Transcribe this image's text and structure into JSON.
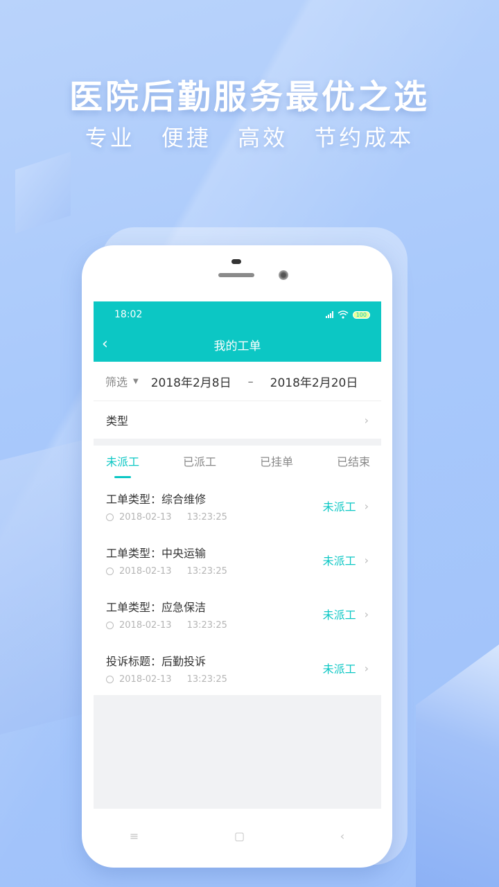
{
  "promo": {
    "headline": "医院后勤服务最优之选",
    "tags": [
      "专业",
      "便捷",
      "高效",
      "节约成本"
    ]
  },
  "status": {
    "time": "18:02",
    "battery": "100"
  },
  "appbar": {
    "title": "我的工单"
  },
  "filter": {
    "label": "筛选",
    "start_date": "2018年2月8日",
    "separator": "–",
    "end_date": "2018年2月20日"
  },
  "type_row": {
    "label": "类型"
  },
  "tabs": [
    "未派工",
    "已派工",
    "已挂单",
    "已结束"
  ],
  "orders": [
    {
      "title": "工单类型：综合维修",
      "date": "2018-02-13",
      "time": "13:23:25",
      "status": "未派工"
    },
    {
      "title": "工单类型：中央运输",
      "date": "2018-02-13",
      "time": "13:23:25",
      "status": "未派工"
    },
    {
      "title": "工单类型：应急保洁",
      "date": "2018-02-13",
      "time": "13:23:25",
      "status": "未派工"
    },
    {
      "title": "投诉标题：后勤投诉",
      "date": "2018-02-13",
      "time": "13:23:25",
      "status": "未派工"
    }
  ],
  "colors": {
    "accent": "#0cc7c4"
  },
  "icons": {
    "back": "chevron-left-icon",
    "row_arrow": "chevron-right-icon",
    "nav": [
      "menu-icon",
      "home-square-icon",
      "back-triangle-icon"
    ]
  }
}
